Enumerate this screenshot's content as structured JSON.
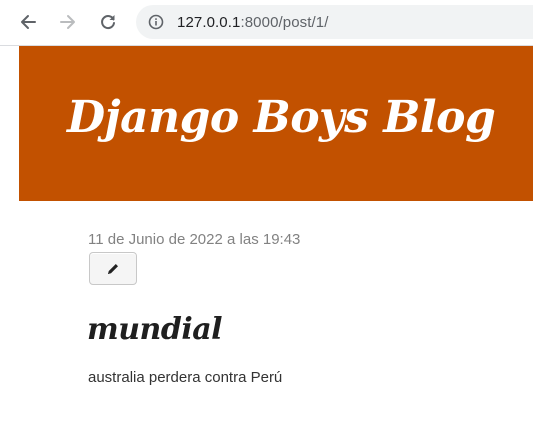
{
  "browser": {
    "url_host": "127.0.0.1",
    "url_rest": ":8000/post/1/",
    "icons": {
      "back": "back-arrow-icon",
      "forward": "forward-arrow-icon",
      "reload": "reload-icon",
      "site_info": "info-icon"
    }
  },
  "site": {
    "title": "Django Boys Blog",
    "banner_color": "#c25100"
  },
  "post": {
    "date": "11 de Junio de 2022 a las 19:43",
    "edit_icon": "pencil-icon",
    "title": "mundial",
    "text": "australia perdera contra Perú"
  }
}
